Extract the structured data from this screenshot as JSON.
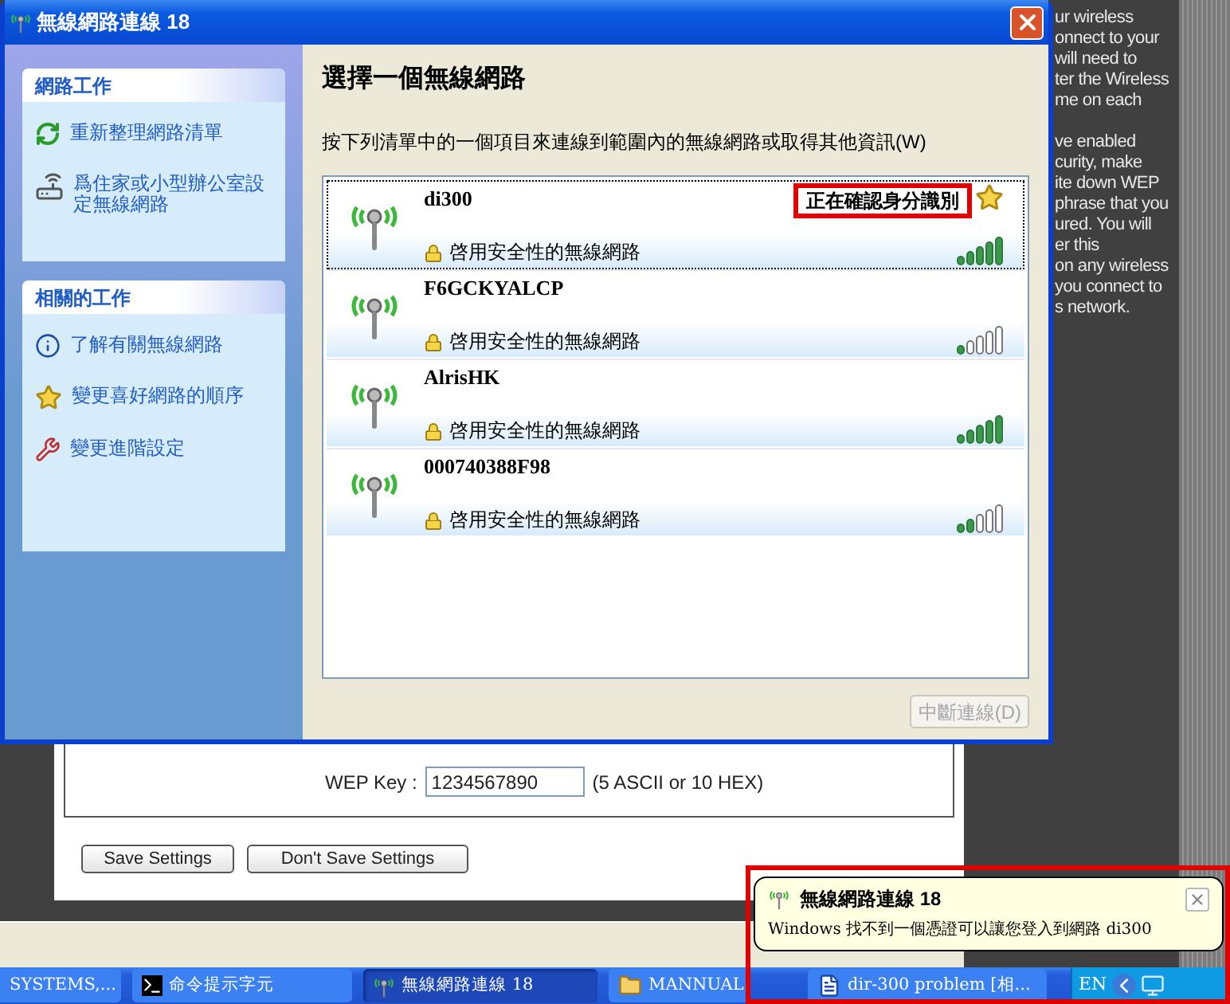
{
  "dialog": {
    "title": "無線網路連線 18",
    "sidebar": [
      {
        "heading": "網路工作",
        "items": [
          {
            "label": "重新整理網路清單",
            "kind": "refresh"
          },
          {
            "label": "爲住家或小型辦公室設定無線網路",
            "kind": "setup"
          }
        ]
      },
      {
        "heading": "相關的工作",
        "items": [
          {
            "label": "了解有關無線網路",
            "kind": "info"
          },
          {
            "label": "變更喜好網路的順序",
            "kind": "star"
          },
          {
            "label": "變更進階設定",
            "kind": "tools"
          }
        ]
      }
    ],
    "heading": "選擇一個無線網路",
    "instructions": "按下列清單中的一個項目來連線到範圍內的無線網路或取得其他資訊(W)",
    "networks": [
      {
        "name": "di300",
        "status": "正在確認身分識別",
        "highlighted": true,
        "preferred": true,
        "security": "啓用安全性的無線網路",
        "level": 1,
        "selected": true
      },
      {
        "name": "F6GCKYALCP",
        "security": "啓用安全性的無線網路",
        "level": 0.2,
        "selected": false
      },
      {
        "name": "AlrisHK",
        "security": "啓用安全性的無線網路",
        "level": 1,
        "selected": false
      },
      {
        "name": "000740388F98",
        "security": "啓用安全性的無線網路",
        "level": 0.4,
        "selected": false
      }
    ],
    "disconnect_button": {
      "label": "中斷連線(D)",
      "disabled": true
    }
  },
  "web_page": {
    "wep_key_label": "WEP Key :",
    "wep_key_value": "1234567890",
    "wep_key_hint": "(5 ASCII or 10 HEX)",
    "buttons": [
      "Save Settings",
      "Don't Save Settings"
    ]
  },
  "side_text": [
    [
      "ur wireless",
      "onnect to your",
      "will need to",
      "ter the Wireless",
      "me on each"
    ],
    [
      "ve enabled",
      "curity, make",
      "ite down WEP",
      "phrase that you",
      "ured. You will",
      "er this",
      "on any wireless",
      "you connect to",
      "s network."
    ]
  ],
  "taskbar": {
    "items": [
      {
        "label": "SYSTEMS,...",
        "kind": "plain",
        "selected": false
      },
      {
        "label": "命令提示字元",
        "kind": "console",
        "selected": false
      },
      {
        "label": "無線網路連線 18",
        "kind": "wireless",
        "selected": true
      },
      {
        "label": "MANNUAL",
        "kind": "folder",
        "selected": false
      },
      {
        "label": "dir-300 problem [相...",
        "kind": "document",
        "selected": false
      }
    ],
    "language": "EN"
  },
  "balloon": {
    "title": "無線網路連線 18",
    "message": "Windows 找不到一個憑證可以讓您登入到網路 di300",
    "highlighted": true
  }
}
